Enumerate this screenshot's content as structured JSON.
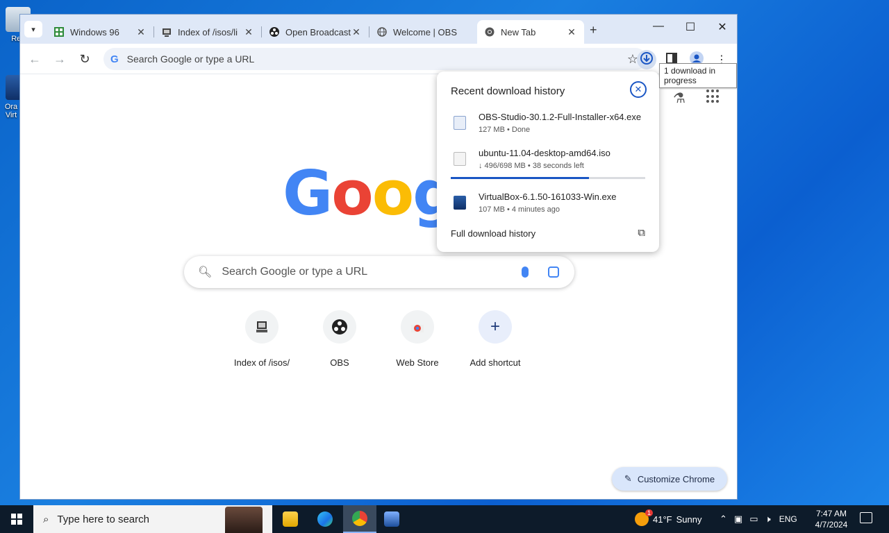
{
  "desktop": {
    "icons": [
      {
        "label": "Rec",
        "icon": "recycle-bin-icon"
      },
      {
        "label": "Ora Virt",
        "icon": "virtualbox-icon"
      }
    ]
  },
  "browser": {
    "tabs": [
      {
        "title": "Windows 96",
        "icon": "windows96-icon"
      },
      {
        "title": "Index of /isos/li",
        "icon": "server-icon"
      },
      {
        "title": "Open Broadcast",
        "icon": "obs-icon"
      },
      {
        "title": "Welcome | OBS",
        "icon": "globe-icon"
      },
      {
        "title": "New Tab",
        "icon": "chrome-icon",
        "active": true
      }
    ],
    "new_tab_symbol": "+",
    "window_controls": {
      "minimize": "—",
      "maximize": "☐",
      "close": "✕"
    },
    "omnibox": {
      "placeholder": "Search Google or type a URL",
      "g_glyph": "G"
    },
    "download_tooltip": "1 download in progress",
    "download_panel": {
      "title": "Recent download history",
      "items": [
        {
          "name": "OBS-Studio-30.1.2-Full-Installer-x64.exe",
          "meta": "127 MB • Done"
        },
        {
          "name": "ubuntu-11.04-desktop-amd64.iso",
          "meta": "↓ 496/698 MB • 38 seconds left",
          "progress": 0.71
        },
        {
          "name": "VirtualBox-6.1.50-161033-Win.exe",
          "meta": "107 MB • 4 minutes ago"
        }
      ],
      "footer": "Full download history"
    },
    "ntp": {
      "logo_letters": [
        "G",
        "o",
        "o",
        "g"
      ],
      "logo_colors": [
        "#4285f4",
        "#ea4335",
        "#fbbc05",
        "#4285f4"
      ],
      "search_placeholder": "Search Google or type a URL",
      "shortcuts": [
        {
          "name": "Index of /isos/",
          "icon": "server-icon"
        },
        {
          "name": "OBS",
          "icon": "obs-icon"
        },
        {
          "name": "Web Store",
          "icon": "chrome-webstore-icon"
        },
        {
          "name": "Add shortcut",
          "icon": "plus-icon"
        }
      ],
      "customize_label": "Customize Chrome"
    }
  },
  "taskbar": {
    "search_placeholder": "Type here to search",
    "weather": {
      "temp": "41°F",
      "condition": "Sunny",
      "badge": "1"
    },
    "language": "ENG",
    "time": "7:47 AM",
    "date": "4/7/2024"
  }
}
